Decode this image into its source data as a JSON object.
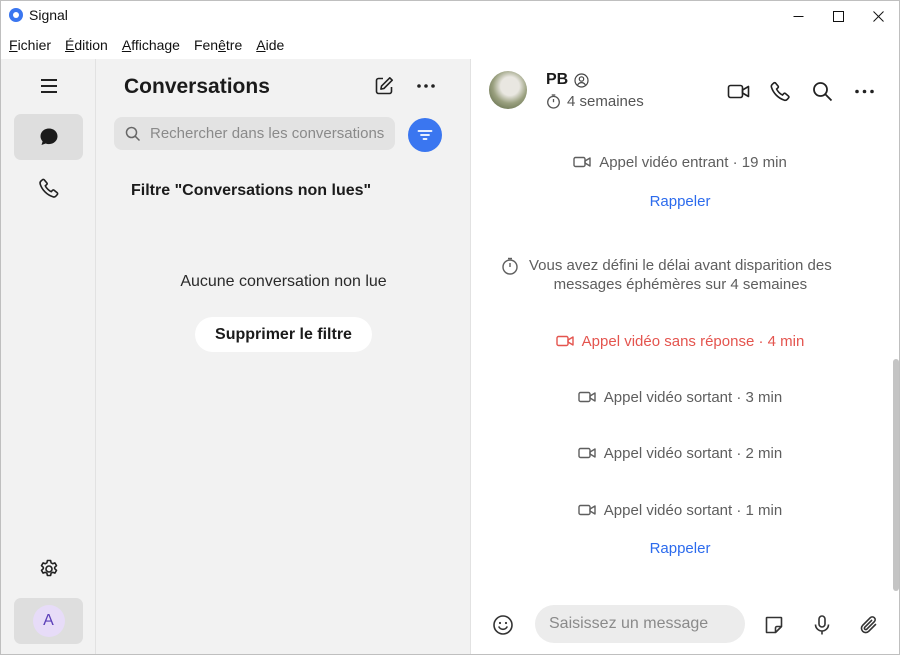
{
  "window": {
    "title": "Signal"
  },
  "menu": [
    {
      "label": "Fichier",
      "underline": "F",
      "rest": "ichier"
    },
    {
      "label": "Édition",
      "underline": "É",
      "rest": "dition"
    },
    {
      "label": "Affichage",
      "underline": "A",
      "rest": "ffichage"
    },
    {
      "label": "Fenêtre",
      "underline_pre": "Fen",
      "underline": "ê",
      "rest": "tre"
    },
    {
      "label": "Aide",
      "underline": "A",
      "rest": "ide"
    }
  ],
  "rail": {
    "items": [
      "menu-icon",
      "chats-icon",
      "calls-icon",
      "settings-icon"
    ],
    "avatar_initial": "A"
  },
  "conversations": {
    "title": "Conversations",
    "search_placeholder": "Rechercher dans les conversations",
    "filter_heading": "Filtre \"Conversations non lues\"",
    "empty_text": "Aucune conversation non lue",
    "clear_filter_label": "Supprimer le filtre"
  },
  "chat": {
    "contact_name": "PB",
    "disappearing_timer": "4 semaines",
    "events": {
      "incoming": "Appel vidéo entrant · 19 min",
      "callback_1": "Rappeler",
      "timer_line1": "Vous avez défini le délai avant disparition des",
      "timer_line2": "messages éphémères sur 4 semaines",
      "missed": "Appel vidéo sans réponse · 4 min",
      "outgoing_3": "Appel vidéo sortant · 3 min",
      "outgoing_2": "Appel vidéo sortant · 2 min",
      "outgoing_1": "Appel vidéo sortant · 1 min",
      "callback_2": "Rappeler"
    },
    "composer_placeholder": "Saisissez un message"
  },
  "colors": {
    "accent": "#3a76f0",
    "link": "#2c6bed",
    "missed": "#e4544e",
    "pane_bg": "#f2f2f2"
  }
}
